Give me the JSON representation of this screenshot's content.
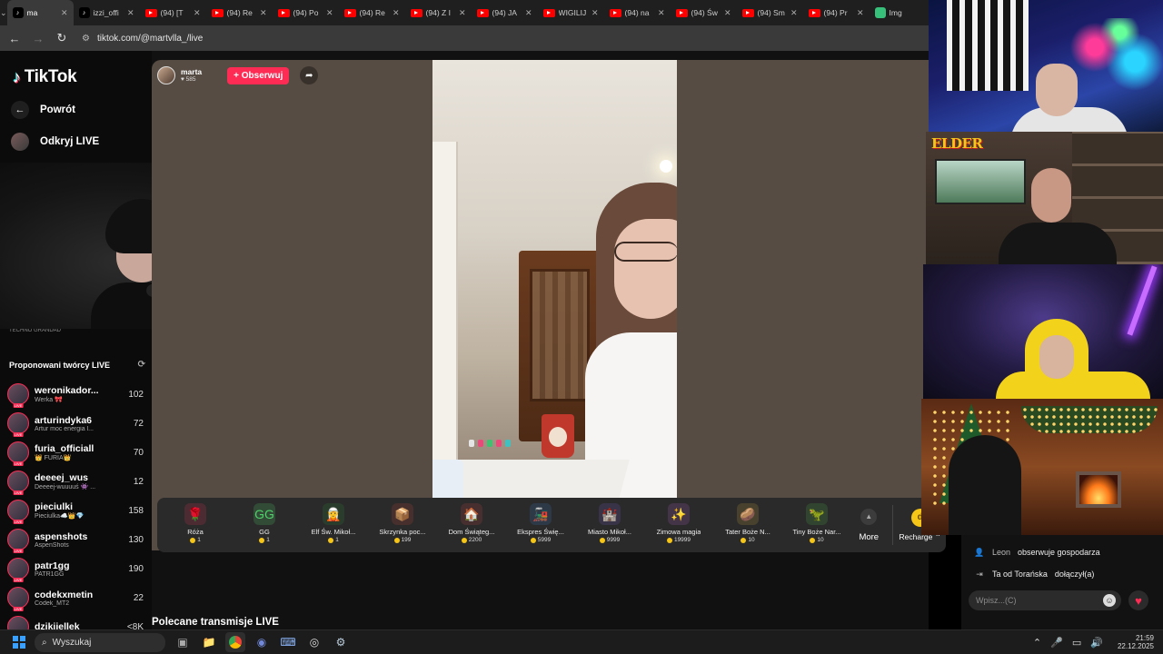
{
  "browser": {
    "tabs": [
      {
        "label": "ma",
        "favicon": "tiktok",
        "active": true
      },
      {
        "label": "izzi_offi",
        "favicon": "tiktok",
        "active": false
      },
      {
        "label": "(94) [T",
        "favicon": "youtube",
        "active": false
      },
      {
        "label": "(94) Re",
        "favicon": "youtube",
        "active": false
      },
      {
        "label": "(94) Po",
        "favicon": "youtube",
        "active": false
      },
      {
        "label": "(94) Re",
        "favicon": "youtube",
        "active": false
      },
      {
        "label": "(94) Z I",
        "favicon": "youtube",
        "active": false
      },
      {
        "label": "(94) JA",
        "favicon": "youtube",
        "active": false
      },
      {
        "label": "WIGILIJ",
        "favicon": "youtube",
        "active": false
      },
      {
        "label": "(94) na",
        "favicon": "youtube",
        "active": false
      },
      {
        "label": "(94) Św",
        "favicon": "youtube",
        "active": false
      },
      {
        "label": "(94) Sm",
        "favicon": "youtube",
        "active": false
      },
      {
        "label": "(94) Pr",
        "favicon": "youtube",
        "active": false
      },
      {
        "label": "Img",
        "favicon": "image",
        "active": false
      }
    ],
    "url": "tiktok.com/@martvlla_/live"
  },
  "sidebar": {
    "logo": "TikTok",
    "back_label": "Powrót",
    "discover_label": "Odkryj LIVE",
    "partial_text": "TECHNO GRANDAD",
    "suggested_title": "Proponowani twórcy LIVE",
    "suggested": [
      {
        "name": "weronikador...",
        "sub": "Werka 🎀",
        "count": "102"
      },
      {
        "name": "arturindyka6",
        "sub": "Artur moc energia l...",
        "count": "72"
      },
      {
        "name": "furia_officiall",
        "sub": "👑 FURIA👑",
        "count": "70"
      },
      {
        "name": "deeeej_wus",
        "sub": "Deeeej-wuuuuś 👾 ...",
        "count": "12"
      },
      {
        "name": "pieciulki",
        "sub": "Pieciulka☁️👑💎",
        "count": "158"
      },
      {
        "name": "aspenshots",
        "sub": "AspenShots",
        "count": "130"
      },
      {
        "name": "patr1gg",
        "sub": "PATR1GG",
        "count": "190"
      },
      {
        "name": "codekxmetin",
        "sub": "Codek_MT2",
        "count": "22"
      },
      {
        "name": "dzikijellek",
        "sub": "",
        "count": "<8K"
      }
    ]
  },
  "stream": {
    "host_name": "marta",
    "host_likes": "585",
    "follow_label": "+ Obserwuj"
  },
  "gifts": [
    {
      "name": "Róża",
      "price": "1",
      "icon": "🌹",
      "color": "#d9305a"
    },
    {
      "name": "GG",
      "price": "1",
      "icon": "GG",
      "color": "#4fd06a"
    },
    {
      "name": "Elf Św. Mikoł...",
      "price": "1",
      "icon": "🧝",
      "color": "#2e8a3e"
    },
    {
      "name": "Skrzynka poc...",
      "price": "199",
      "icon": "📦",
      "color": "#b8453a"
    },
    {
      "name": "Dom Świąteg...",
      "price": "2200",
      "icon": "🏠",
      "color": "#c0464a"
    },
    {
      "name": "Ekspres Świę...",
      "price": "5999",
      "icon": "🚂",
      "color": "#3a7ac0"
    },
    {
      "name": "Miasto Mikoł...",
      "price": "9999",
      "icon": "🏰",
      "color": "#7a58c0"
    },
    {
      "name": "Zimowa magia",
      "price": "19999",
      "icon": "✨",
      "color": "#b060c0"
    },
    {
      "name": "Tater Boże N...",
      "price": "10",
      "icon": "🥔",
      "color": "#c0a03a"
    },
    {
      "name": "Tiny Boże Nar...",
      "price": "10",
      "icon": "🦖",
      "color": "#4ab04a"
    }
  ],
  "gift_more_label": "More",
  "recharge_label": "Recharge",
  "section_title": "Polecane transmisje LIVE",
  "cams": {
    "elder_logo": "ELDER"
  },
  "chat": {
    "lines": [
      {
        "user": "Leon",
        "text": "obserwuje gospodarza"
      },
      {
        "user": "Ta od Torańska",
        "text": "dołączył(a)"
      }
    ],
    "input_placeholder": "Wpisz...(C)"
  },
  "taskbar": {
    "search_placeholder": "Wyszukaj",
    "time": "21:59",
    "date": "22.12.2025"
  },
  "colors": {
    "brand_pink": "#fe2c55",
    "stage_bg": "#574c43"
  }
}
